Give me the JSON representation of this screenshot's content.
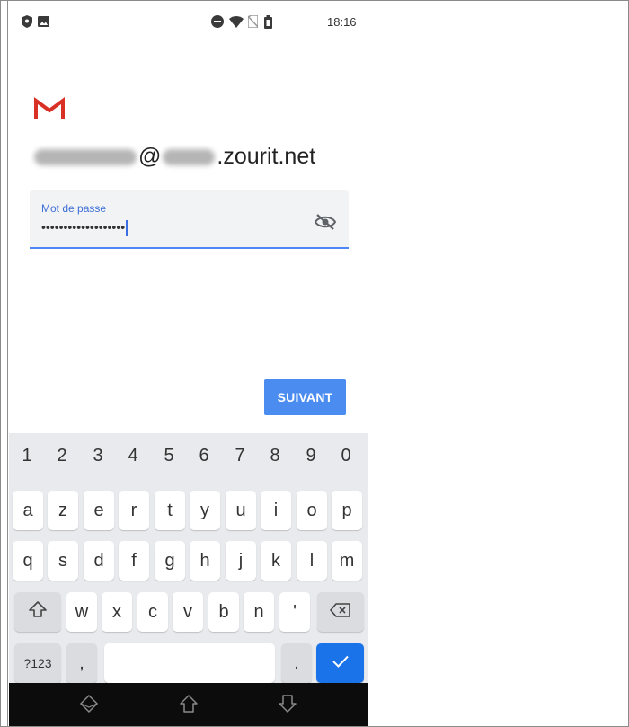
{
  "status_bar": {
    "time": "18:16",
    "left_icons": [
      "shield-icon",
      "image-icon"
    ],
    "right_icons": [
      "do-not-disturb-icon",
      "wifi-icon",
      "no-sim-icon",
      "battery-icon"
    ]
  },
  "account": {
    "email_local_blurred": "",
    "email_at": "@",
    "email_domain_blurred": "",
    "email_suffix": ".zourit.net"
  },
  "password_field": {
    "label": "Mot de passe",
    "value": "•••••••••••••••••••",
    "toggle_icon": "visibility-off-icon",
    "accent_color": "#4f86f7"
  },
  "next_button": {
    "label": "SUIVANT",
    "color": "#4a8cf0"
  },
  "keyboard": {
    "numbers": [
      "1",
      "2",
      "3",
      "4",
      "5",
      "6",
      "7",
      "8",
      "9",
      "0"
    ],
    "row1": [
      "a",
      "z",
      "e",
      "r",
      "t",
      "y",
      "u",
      "i",
      "o",
      "p"
    ],
    "row2": [
      "q",
      "s",
      "d",
      "f",
      "g",
      "h",
      "j",
      "k",
      "l",
      "m"
    ],
    "row3": [
      "w",
      "x",
      "c",
      "v",
      "b",
      "n",
      "'"
    ],
    "symbols_label": "?123",
    "comma": ",",
    "period": ".",
    "enter_color": "#1a73e8"
  },
  "nav_bar": {
    "icons": [
      "back-icon",
      "home-icon",
      "recents-icon"
    ]
  }
}
